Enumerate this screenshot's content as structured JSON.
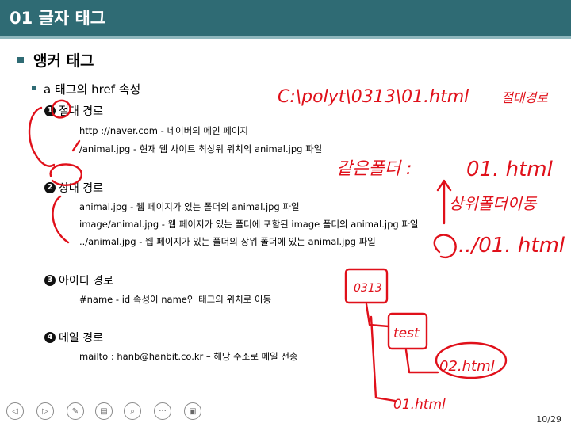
{
  "title": "01 글자 태그",
  "heading": "앵커 태그",
  "subheading": "a 태그의 href 속성",
  "sections": [
    {
      "num": "1",
      "label": "절대 경로",
      "items": [
        "http ://naver.com - 네이버의 메인 페이지",
        "/animal.jpg - 현재 웹 사이트 최상위 위치의 animal.jpg 파일"
      ]
    },
    {
      "num": "2",
      "label": "상대 경로",
      "items": [
        "animal.jpg - 웹 페이지가 있는 폴더의 animal.jpg 파일",
        "image/animal.jpg - 웹 페이지가 있는 폴더에 포함된 image 폴더의 animal.jpg 파일",
        "../animal.jpg - 웹 페이지가 있는 폴더의 상위 폴더에 있는 animal.jpg 파일"
      ]
    },
    {
      "num": "3",
      "label": "아이디 경로",
      "items": [
        "#name - id 속성이 name인 태그의 위치로 이동"
      ]
    },
    {
      "num": "4",
      "label": "메일 경로",
      "items": [
        "mailto : hanb@hanbit.co.kr – 해당 주소로 메일 전송"
      ]
    }
  ],
  "annotations": {
    "path": "C:\\polyt\\0313\\01.html",
    "absolute": "절대경로",
    "same_folder": "같은폴더 :",
    "file01": "01. html",
    "up_folder": "상위폴더이동",
    "parent_file": "../01. html",
    "folder_0313": "0313",
    "folder_test": "test",
    "file02": "02.html",
    "file01b": "01.html"
  },
  "page": "10/29",
  "toolbar_icons": [
    "prev-icon",
    "next-icon",
    "pen-icon",
    "slides-icon",
    "zoom-icon",
    "more-icon",
    "screen-icon"
  ],
  "colors": {
    "titlebar": "#2f6b74",
    "ink": "#e0101a"
  }
}
